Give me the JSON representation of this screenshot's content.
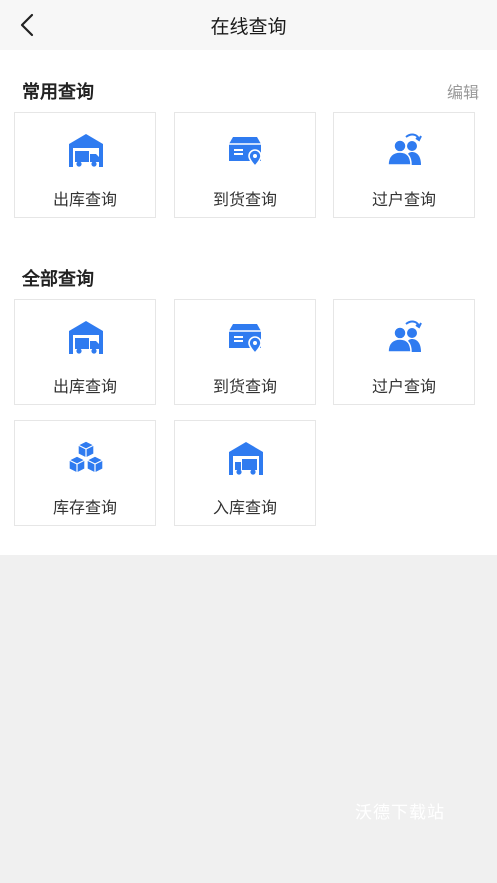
{
  "header": {
    "title": "在线查询",
    "back_icon": "back-arrow-icon"
  },
  "common": {
    "title": "常用查询",
    "edit_label": "编辑",
    "items": [
      {
        "label": "出库查询",
        "icon": "warehouse-truck-icon"
      },
      {
        "label": "到货查询",
        "icon": "package-location-icon"
      },
      {
        "label": "过户查询",
        "icon": "user-transfer-icon"
      }
    ]
  },
  "all": {
    "title": "全部查询",
    "items": [
      {
        "label": "出库查询",
        "icon": "warehouse-truck-icon"
      },
      {
        "label": "到货查询",
        "icon": "package-location-icon"
      },
      {
        "label": "过户查询",
        "icon": "user-transfer-icon"
      },
      {
        "label": "库存查询",
        "icon": "boxes-stack-icon"
      },
      {
        "label": "入库查询",
        "icon": "warehouse-inbound-icon"
      }
    ]
  },
  "watermark": "沃德下载站",
  "colors": {
    "accent": "#2f7bf0",
    "background": "#f0f0f0",
    "panel": "#ffffff"
  }
}
